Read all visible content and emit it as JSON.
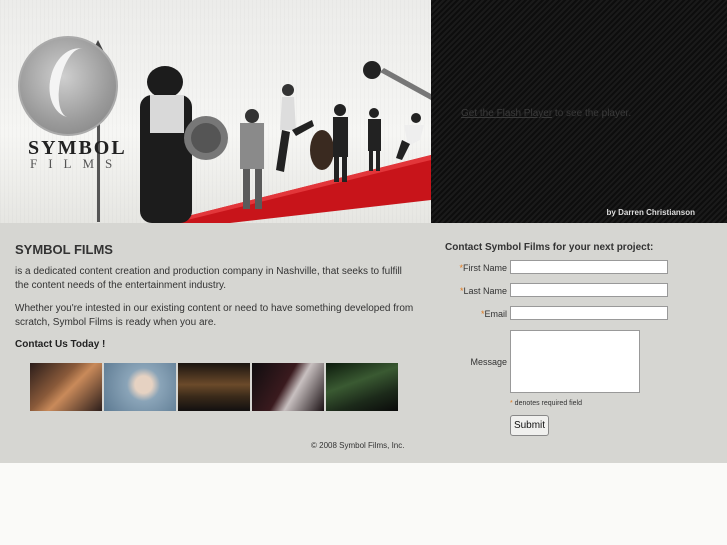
{
  "header": {
    "logo": {
      "word": "SYMBOL",
      "sub": "FILMS"
    },
    "player": {
      "flash_link": "Get the Flash Player",
      "flash_tail": " to see the player.",
      "byline": "by Darren Christianson"
    }
  },
  "intro": {
    "title": "SYMBOL FILMS",
    "paragraph1": "is a dedicated content creation and production company in Nashville, that seeks to fulfill the content needs of the entertainment industry.",
    "paragraph2": "Whether you're intested in our existing content or need to have something developed from scratch, Symbol Films is ready when you are.",
    "cta": "Contact Us Today !"
  },
  "thumbnails": [
    "thumb-1",
    "thumb-2",
    "thumb-3",
    "thumb-4",
    "thumb-5"
  ],
  "footer": {
    "copyright": "© 2008 Symbol Films, Inc."
  },
  "form": {
    "title": "Contact Symbol Films for your next project:",
    "first_name_label": "First Name",
    "last_name_label": "Last Name",
    "email_label": "Email",
    "message_label": "Message",
    "required_mark": "*",
    "required_note": " denotes required field",
    "submit_label": "Submit"
  },
  "colors": {
    "panel": "#d6d6d2",
    "player_bg": "#111111",
    "carpet": "#c8141a",
    "required": "#e07a20"
  }
}
